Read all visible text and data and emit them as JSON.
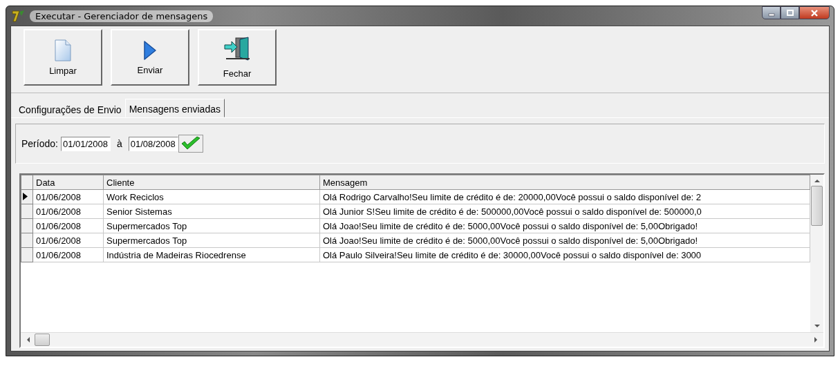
{
  "window": {
    "title": "Executar - Gerenciador de mensagens"
  },
  "toolbar": [
    {
      "kind": "clear",
      "label": "Limpar"
    },
    {
      "kind": "send",
      "label": "Enviar"
    },
    {
      "kind": "exit",
      "label": "Fechar"
    }
  ],
  "tabs": [
    {
      "label": "Configurações de Envio",
      "selected": false
    },
    {
      "label": "Mensagens enviadas",
      "selected": true
    }
  ],
  "filter": {
    "label": "Período:",
    "from": "01/01/2008",
    "separator": "à",
    "to": "01/08/2008"
  },
  "table": {
    "columns": [
      "Data",
      "Cliente",
      "Mensagem"
    ],
    "rows": [
      {
        "selected": true,
        "cells": [
          "01/06/2008",
          "Work Reciclos",
          "Olá Rodrigo Carvalho!Seu limite de crédito é de: 20000,00Você possui o saldo disponível de: 2"
        ]
      },
      {
        "selected": false,
        "cells": [
          "01/06/2008",
          "Senior Sistemas",
          "Olá Junior S!Seu limite de crédito é de: 500000,00Você possui o saldo disponível de: 500000,0"
        ]
      },
      {
        "selected": false,
        "cells": [
          "01/06/2008",
          "Supermercados Top",
          "Olá Joao!Seu limite de crédito é de: 5000,00Você possui o saldo disponível de: 5,00Obrigado!"
        ]
      },
      {
        "selected": false,
        "cells": [
          "01/06/2008",
          "Supermercados Top",
          "Olá Joao!Seu limite de crédito é de: 5000,00Você possui o saldo disponível de: 5,00Obrigado!"
        ]
      },
      {
        "selected": false,
        "cells": [
          "01/06/2008",
          "Indústria de Madeiras Riocedrense",
          "Olá Paulo Silveira!Seu limite de crédito é de: 30000,00Você possui o saldo disponível de: 3000"
        ]
      }
    ]
  }
}
